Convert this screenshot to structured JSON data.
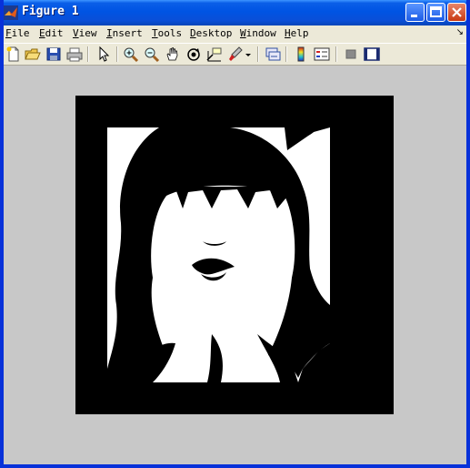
{
  "window": {
    "title": "Figure 1",
    "icon": "matlab-logo-icon",
    "controls": [
      "minimize-icon",
      "maximize-icon",
      "close-icon"
    ]
  },
  "menu": {
    "items": [
      {
        "label": "File",
        "accel": "F"
      },
      {
        "label": "Edit",
        "accel": "E"
      },
      {
        "label": "View",
        "accel": "V"
      },
      {
        "label": "Insert",
        "accel": "I"
      },
      {
        "label": "Tools",
        "accel": "T"
      },
      {
        "label": "Desktop",
        "accel": "D"
      },
      {
        "label": "Window",
        "accel": "W"
      },
      {
        "label": "Help",
        "accel": "H"
      }
    ],
    "dock_arrow": "↘"
  },
  "toolbar": {
    "tools": [
      "new-figure-icon",
      "open-file-icon",
      "save-icon",
      "print-icon",
      "edit-plot-icon",
      "zoom-in-icon",
      "zoom-out-icon",
      "pan-icon",
      "rotate-3d-icon",
      "data-cursor-icon",
      "brush-icon",
      "link-plot-icon",
      "colorbar-icon",
      "legend-icon",
      "hide-plot-tools-icon",
      "show-plot-tools-icon"
    ]
  },
  "figure": {
    "background": "#C8C8C8",
    "image": "binary black and white portrait"
  }
}
